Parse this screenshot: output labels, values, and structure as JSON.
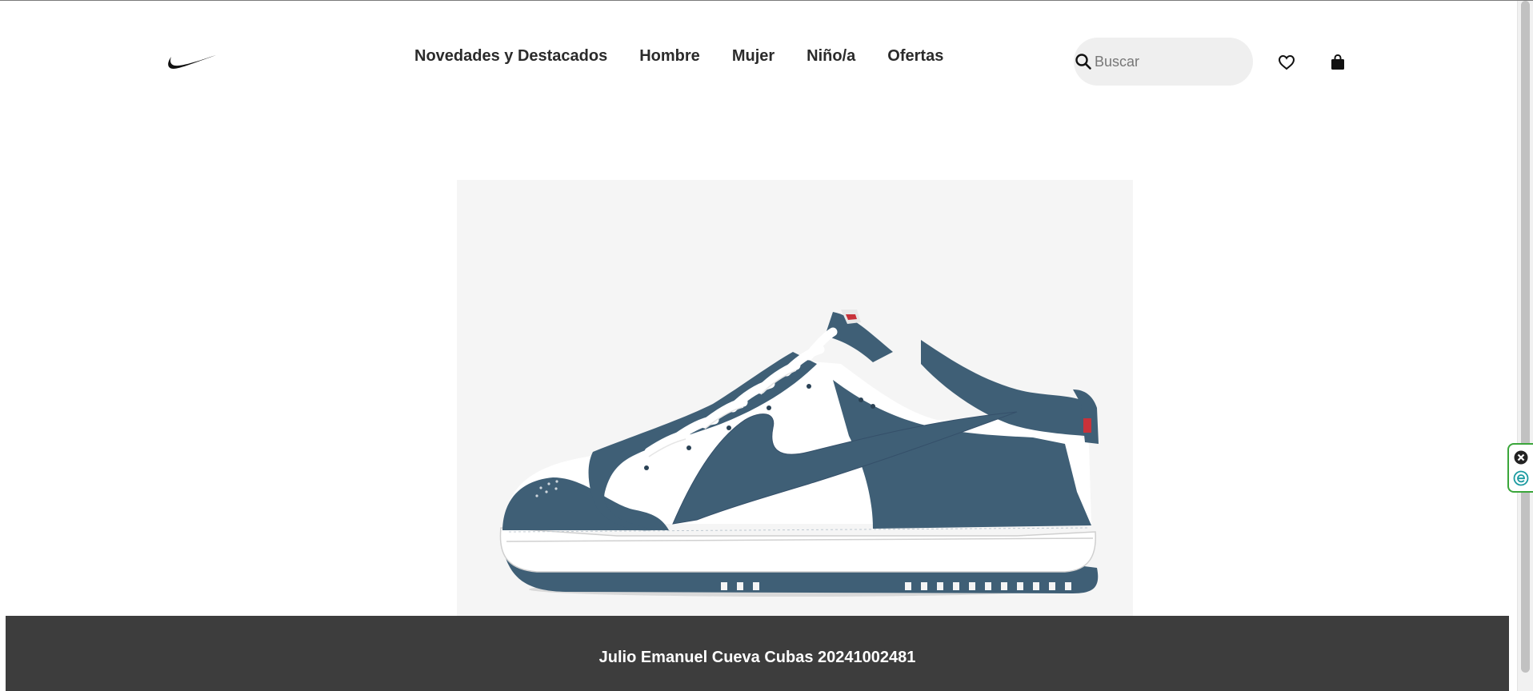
{
  "header": {
    "brand_logo": "nike-swoosh-icon",
    "nav": [
      {
        "label": "Novedades y Destacados"
      },
      {
        "label": "Hombre"
      },
      {
        "label": "Mujer"
      },
      {
        "label": "Niño/a"
      },
      {
        "label": "Ofertas"
      }
    ],
    "search": {
      "placeholder": "Buscar",
      "icon": "search-icon"
    },
    "favorites_icon": "heart-icon",
    "bag_icon": "shopping-bag-icon"
  },
  "hero": {
    "image": "sneaker-image",
    "colors": {
      "background": "#f5f5f5",
      "leather": "#3f5f76",
      "white": "#ffffff",
      "accent": "#c8323a"
    }
  },
  "footer": {
    "credit": "Julio Emanuel Cueva Cubas 20241002481",
    "background": "#3d3d3d"
  },
  "extension": {
    "buttons": [
      {
        "icon": "close-circle-icon"
      },
      {
        "icon": "e-icon"
      }
    ],
    "accent": "#3aa63a"
  }
}
